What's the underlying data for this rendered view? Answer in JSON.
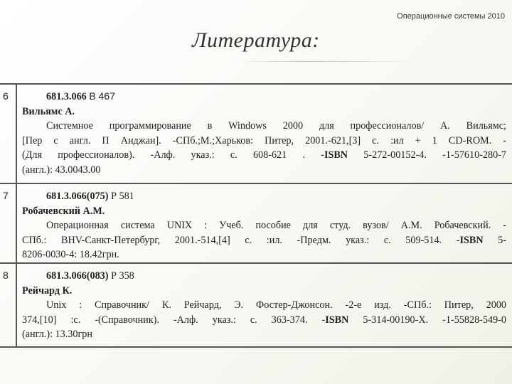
{
  "header": {
    "text": "Операционные системы 2010"
  },
  "title": "Литература:",
  "entries": [
    {
      "num": "6",
      "code": "681.3.066",
      "letter": "В",
      "code_num": "467",
      "author": "Вильямс А.",
      "lines": [
        "Системное программирование в Windows 2000 для профессионалов/ А. Вильямс;",
        "[Пер с англ. П Анджан]. -СПб.;М.;Харьков: Питер, 2001.-621,[3] с. :ил + 1 CD-ROM. -",
        "(Для профессионалов). -Алф. указ.: с. 608-621 . -",
        "(англ.): 43.0043.00"
      ],
      "isbn_label": "ISBN",
      "isbn_tail": " 5-272-00152-4. -1-57610-280-7"
    },
    {
      "num": "7",
      "code": "681.3.066(075)",
      "letter": "Р",
      "code_num": "581",
      "author": "Робачевский А.М.",
      "lines": [
        "Операционная система UNIX : Учеб. пособие для студ. вузов/ А.М. Робачевский. -",
        "СПб.: BHV-Санкт-Петербург, 2001.-514,[4] с. :ил. -Предм. указ.: с. 509-514. -",
        "8206-0030-4: 18.42грн."
      ],
      "isbn_label": "ISBN",
      "isbn_tail": " 5-"
    },
    {
      "num": "8",
      "code": "681.3.066(083)",
      "letter": "Р",
      "code_num": "358",
      "author": "Рейчард К.",
      "lines": [
        "Unix : Справочник/ К. Рейчард, Э. Фостер-Джонсон. -2-е изд. -СПб.: Питер, 2000",
        "374,[10] :с. -(Справочник). -Алф. указ.: с. 363-374. -",
        "(англ.): 13.30грн"
      ],
      "isbn_label": "ISBN",
      "isbn_tail": " 5-314-00190-X. -1-55828-549-0"
    }
  ]
}
